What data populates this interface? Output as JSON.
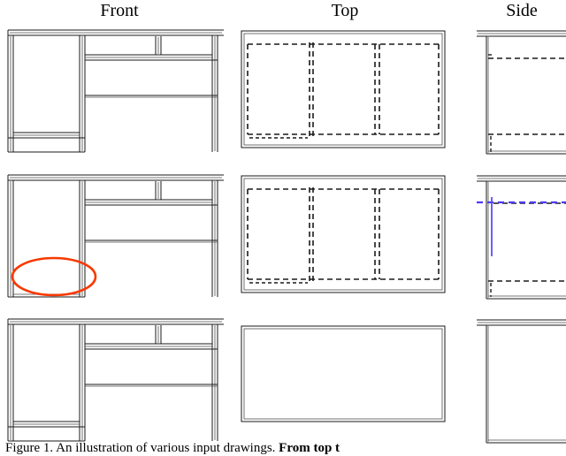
{
  "headers": {
    "front": "Front",
    "top": "Top",
    "side": "Side"
  },
  "caption": {
    "label": "Figure 1.",
    "text": "An illustration of various input drawings.",
    "bold_tail": "From top t"
  },
  "colors": {
    "line": "#1a1a1a",
    "thin_line": "#4d4d4d",
    "annotation_ellipse": "#f93800",
    "annotation_blue": "#4b3bf5",
    "background": "#ffffff"
  },
  "figure": {
    "type": "orthographic-cad-drawing",
    "subject": "desk",
    "columns": [
      "Front",
      "Top",
      "Side"
    ],
    "rows": [
      {
        "index": 1,
        "views": {
          "front": {
            "description": "Desk front elevation: left closed cabinet panel, right open leg span, top drawer band with divider, lower shelf inside cabinet",
            "hidden_lines": false,
            "annotations": []
          },
          "top": {
            "description": "Desk top plan: outer rectangle with dashed hidden lines showing cabinet, drawer and leg positions",
            "hidden_lines": true,
            "annotations": []
          },
          "side": {
            "description": "Desk side elevation with overhanging top bar and dashed hidden lines at drawer and bottom shelf",
            "hidden_lines": true,
            "annotations": []
          }
        }
      },
      {
        "index": 2,
        "views": {
          "front": {
            "description": "Same desk front elevation with missing bottom shelf detail circled",
            "hidden_lines": false,
            "annotations": [
              {
                "kind": "ellipse",
                "color": "#f93800",
                "target": "cabinet-bottom-region"
              }
            ]
          },
          "top": {
            "description": "Desk top plan with dashed hidden lines, same as row 1",
            "hidden_lines": true,
            "annotations": []
          },
          "side": {
            "description": "Desk side elevation with blue dashed horizontal line and blue vertical line annotation",
            "hidden_lines": true,
            "annotations": [
              {
                "kind": "dashed-line",
                "color": "#4b3bf5",
                "orientation": "horizontal"
              },
              {
                "kind": "solid-line",
                "color": "#5b52f0",
                "orientation": "vertical"
              }
            ]
          }
        }
      },
      {
        "index": 3,
        "views": {
          "front": {
            "description": "Desk front elevation, identical geometry to row 1",
            "hidden_lines": false,
            "annotations": []
          },
          "top": {
            "description": "Empty outline rectangle only, no hidden lines",
            "hidden_lines": false,
            "annotations": []
          },
          "side": {
            "description": "Plain side outline with top bar, no hidden lines",
            "hidden_lines": false,
            "annotations": []
          }
        }
      }
    ]
  }
}
